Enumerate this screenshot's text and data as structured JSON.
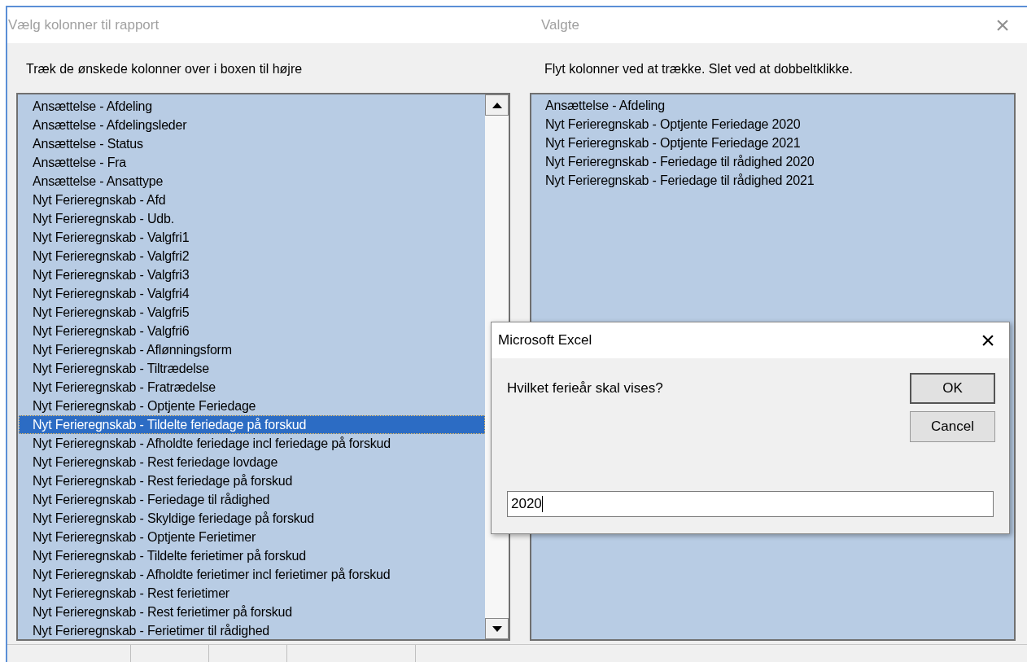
{
  "window": {
    "title": "Vælg kolonner til rapport",
    "title_right": "Valgte",
    "close": "×"
  },
  "left_panel": {
    "instruction": "Træk de ønskede kolonner over i boxen til højre",
    "items": [
      {
        "label": "Ansættelse - Afdeling",
        "selected": false
      },
      {
        "label": "Ansættelse - Afdelingsleder",
        "selected": false
      },
      {
        "label": "Ansættelse - Status",
        "selected": false
      },
      {
        "label": "Ansættelse - Fra",
        "selected": false
      },
      {
        "label": "Ansættelse - Ansattype",
        "selected": false
      },
      {
        "label": "Nyt Ferieregnskab - Afd",
        "selected": false
      },
      {
        "label": "Nyt Ferieregnskab - Udb.",
        "selected": false
      },
      {
        "label": "Nyt Ferieregnskab - Valgfri1",
        "selected": false
      },
      {
        "label": "Nyt Ferieregnskab - Valgfri2",
        "selected": false
      },
      {
        "label": "Nyt Ferieregnskab - Valgfri3",
        "selected": false
      },
      {
        "label": "Nyt Ferieregnskab - Valgfri4",
        "selected": false
      },
      {
        "label": "Nyt Ferieregnskab - Valgfri5",
        "selected": false
      },
      {
        "label": "Nyt Ferieregnskab - Valgfri6",
        "selected": false
      },
      {
        "label": "Nyt Ferieregnskab - Aflønningsform",
        "selected": false
      },
      {
        "label": "Nyt Ferieregnskab - Tiltrædelse",
        "selected": false
      },
      {
        "label": "Nyt Ferieregnskab - Fratrædelse",
        "selected": false
      },
      {
        "label": "Nyt Ferieregnskab - Optjente Feriedage",
        "selected": false
      },
      {
        "label": "Nyt Ferieregnskab - Tildelte feriedage på forskud",
        "selected": true
      },
      {
        "label": "Nyt Ferieregnskab - Afholdte feriedage incl feriedage på forskud",
        "selected": false
      },
      {
        "label": "Nyt Ferieregnskab - Rest feriedage lovdage",
        "selected": false
      },
      {
        "label": "Nyt Ferieregnskab - Rest feriedage på forskud",
        "selected": false
      },
      {
        "label": "Nyt Ferieregnskab - Feriedage til rådighed",
        "selected": false
      },
      {
        "label": "Nyt Ferieregnskab - Skyldige feriedage på forskud",
        "selected": false
      },
      {
        "label": "Nyt Ferieregnskab - Optjente Ferietimer",
        "selected": false
      },
      {
        "label": "Nyt Ferieregnskab - Tildelte ferietimer på forskud",
        "selected": false
      },
      {
        "label": "Nyt Ferieregnskab - Afholdte ferietimer incl ferietimer på forskud",
        "selected": false
      },
      {
        "label": "Nyt Ferieregnskab - Rest ferietimer",
        "selected": false
      },
      {
        "label": "Nyt Ferieregnskab - Rest ferietimer på forskud",
        "selected": false
      },
      {
        "label": "Nyt Ferieregnskab - Ferietimer til rådighed",
        "selected": false
      }
    ]
  },
  "right_panel": {
    "instruction": "Flyt kolonner ved at trække. Slet ved at dobbeltklikke.",
    "items": [
      "Ansættelse - Afdeling",
      "Nyt Ferieregnskab - Optjente Feriedage 2020",
      "Nyt Ferieregnskab - Optjente Feriedage 2021",
      "Nyt Ferieregnskab - Feriedage til rådighed 2020",
      "Nyt Ferieregnskab - Feriedage til rådighed 2021"
    ]
  },
  "dialog": {
    "title": "Microsoft Excel",
    "close": "×",
    "message": "Hvilket ferieår skal vises?",
    "buttons": [
      {
        "label": "OK",
        "default": true
      },
      {
        "label": "Cancel",
        "default": false
      }
    ],
    "input_value": "2020"
  }
}
